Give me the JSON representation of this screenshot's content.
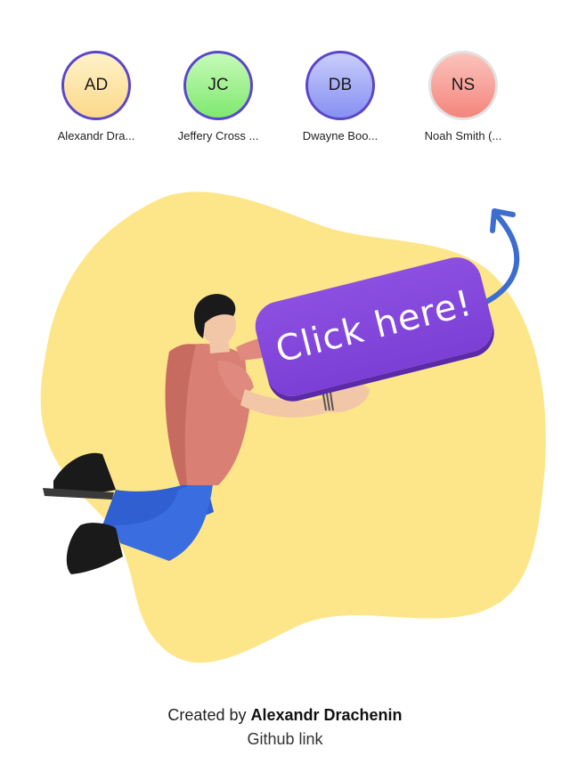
{
  "avatars": [
    {
      "initials": "AD",
      "name": "Alexandr Dra...",
      "color": "#fde29a",
      "active": true
    },
    {
      "initials": "JC",
      "name": "Jeffery Cross ...",
      "color": "#99f08f",
      "active": true
    },
    {
      "initials": "DB",
      "name": "Dwayne Boo...",
      "color": "#9aa3f5",
      "active": true
    },
    {
      "initials": "NS",
      "name": "Noah Smith (...",
      "color": "#f79a93",
      "active": false
    }
  ],
  "cta": {
    "label": "Click here!",
    "color": "#7f45d9"
  },
  "colors": {
    "blob": "#fde68a",
    "arrow": "#3d6ecf",
    "ring_active": "#5b46c9",
    "ring_inactive": "#e2e2e2"
  },
  "footer": {
    "prefix": "Created by",
    "author": "Alexandr Drachenin",
    "link_text": "Github link"
  }
}
